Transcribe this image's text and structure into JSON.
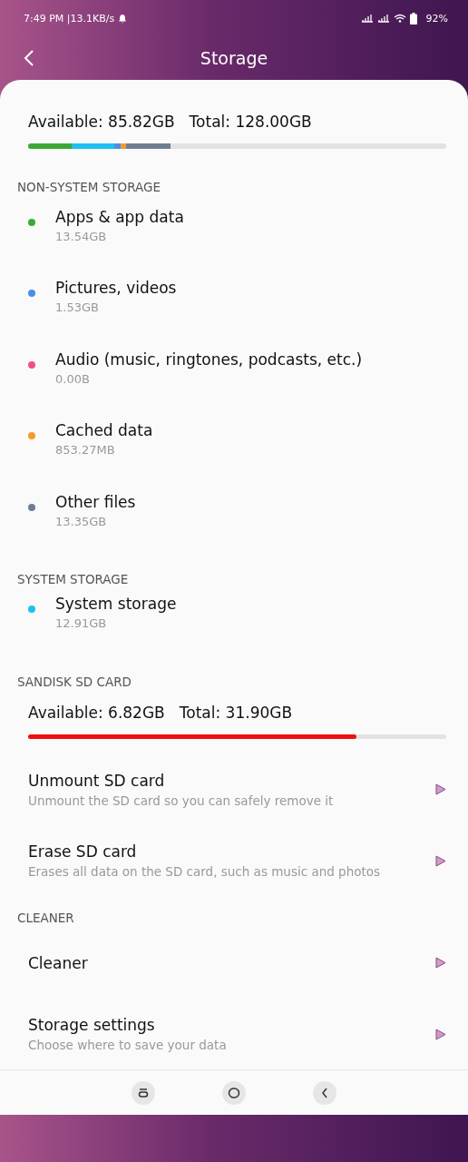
{
  "status_bar": {
    "time": "7:49 PM |13.1KB/s",
    "battery": "92%"
  },
  "header": {
    "title": "Storage"
  },
  "internal": {
    "available": "Available: 85.82GB",
    "total": "Total: 128.00GB",
    "segments": [
      {
        "color": "#3aaa35"
      },
      {
        "color": "#1ec0f0"
      },
      {
        "color": "#4a8ee8"
      },
      {
        "color": "#f39a2e"
      },
      {
        "color": "#6e7e92"
      }
    ]
  },
  "sections": [
    {
      "title": "NON-SYSTEM STORAGE",
      "kind": "dots",
      "items": [
        {
          "name": "Apps & app data",
          "size": "13.54GB",
          "color": "#3aaa35"
        },
        {
          "name": "Pictures, videos",
          "size": "1.53GB",
          "color": "#4a8ee8"
        },
        {
          "name": "Audio (music, ringtones, podcasts, etc.)",
          "size": "0.00B",
          "color": "#f0508a"
        },
        {
          "name": "Cached data",
          "size": "853.27MB",
          "color": "#f39a2e"
        },
        {
          "name": "Other files",
          "size": "13.35GB",
          "color": "#6e7e92"
        }
      ]
    },
    {
      "title": "SYSTEM STORAGE",
      "kind": "dots",
      "items": [
        {
          "name": "System storage",
          "size": "12.91GB",
          "color": "#1ec0f0"
        }
      ]
    },
    {
      "title": "SANDISK SD CARD",
      "kind": "card",
      "available": "Available: 6.82GB",
      "total": "Total: 31.90GB",
      "level": 0.785,
      "items": [
        {
          "name": "Unmount SD card",
          "desc": "Unmount the SD card so you can safely remove it"
        },
        {
          "name": "Erase SD card",
          "desc": "Erases all data on the SD card, such as music and photos"
        }
      ]
    },
    {
      "title": "CLEANER",
      "kind": "links",
      "items": [
        {
          "name": "Cleaner"
        },
        {
          "name": "Storage settings",
          "desc": "Choose where to save your data"
        }
      ]
    }
  ]
}
